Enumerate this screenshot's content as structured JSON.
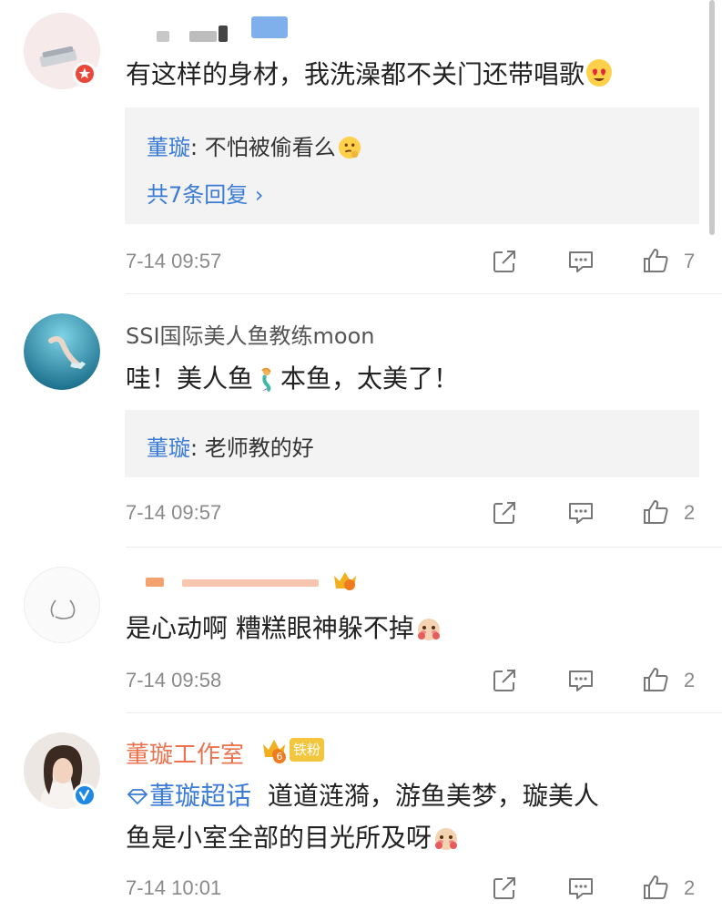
{
  "comments": [
    {
      "username": "",
      "text": "有这样的身材，我洗澡都不关门还带唱歌",
      "emoji": "heart-eyes-emoji",
      "replies": [
        {
          "name": "董璇",
          "sep": ": ",
          "text": "不怕被偷看么",
          "emoji": "thinking-emoji"
        }
      ],
      "more_replies": "共7条回复 ›",
      "time": "7-14 09:57",
      "likes": "7"
    },
    {
      "username": "SSI国际美人鱼教练moon",
      "text_a": "哇！美人鱼",
      "text_b": "本鱼，太美了！",
      "emoji": "mermaid-emoji",
      "replies": [
        {
          "name": "董璇",
          "sep": ": ",
          "text": "老师教的好"
        }
      ],
      "time": "7-14 09:57",
      "likes": "2"
    },
    {
      "username": "",
      "text": "是心动啊 糟糕眼神躲不掉",
      "emoji": "shy-emoji",
      "time": "7-14 09:58",
      "likes": "2"
    },
    {
      "username": "董璇工作室",
      "fan_badge": "铁粉",
      "fan_level": "6",
      "topic": "董璇超话",
      "text_line1": "道道涟漪，游鱼美梦，璇美人",
      "text_line2": "鱼是小室全部的目光所及呀",
      "emoji": "shy-emoji",
      "time": "7-14 10:01",
      "likes": "2"
    }
  ],
  "icons": {
    "share": "share-icon",
    "comment": "comment-icon",
    "like": "thumbs-up-icon"
  },
  "colors": {
    "link_blue": "#3a7bd5",
    "vip_orange": "#eb7350",
    "verified_blue": "#1e88e5",
    "reply_bg": "#f3f3f3",
    "meta_gray": "#8a8a8a"
  }
}
